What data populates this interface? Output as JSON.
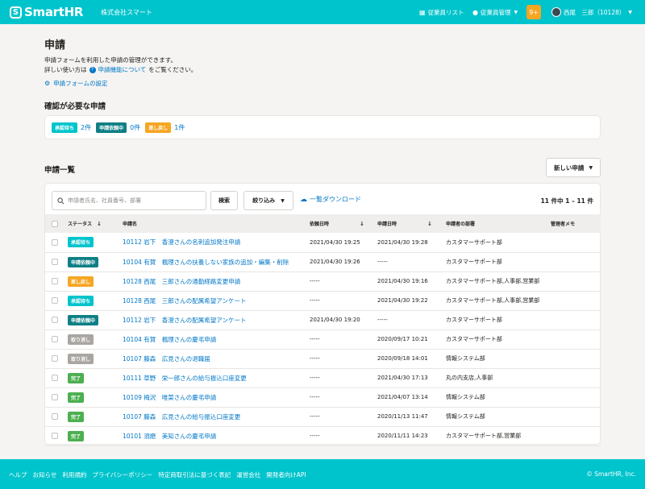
{
  "header": {
    "logo_mark": "S",
    "logo_text": "SmartHR",
    "company": "株式会社スマート",
    "nav_employee_list": "従業員リスト",
    "nav_employee_manage": "従業員管理",
    "notifications": "9+",
    "user": "西尾　三郎（10128）"
  },
  "page": {
    "title": "申請",
    "desc1": "申請フォームを利用した申請の管理ができます。",
    "desc2_pre": "詳しい使い方は",
    "desc2_link": "申請機能について",
    "desc2_post": "をご覧ください。",
    "settings_link": "申請フォームの設定"
  },
  "confirm": {
    "title": "確認が必要な申請",
    "items": [
      {
        "label": "承認待ち",
        "count": "2件",
        "color": "#00c4cc"
      },
      {
        "label": "申請依頼中",
        "count": "0件",
        "color": "#0f7f85"
      },
      {
        "label": "差し戻し",
        "count": "1件",
        "color": "#f5a623"
      }
    ]
  },
  "list": {
    "title": "申請一覧",
    "new_button": "新しい申請",
    "search_placeholder": "申請者氏名、社員番号、部署",
    "search_button": "検索",
    "filter_button": "絞り込み",
    "download_link": "一覧ダウンロード",
    "count_text": "11 件中 1 – 11 件",
    "columns": {
      "status": "ステータス",
      "name": "申請名",
      "requested": "依頼日時",
      "applied": "申請日時",
      "dept": "申請者の部署",
      "memo": "管理者メモ"
    },
    "rows": [
      {
        "status": "承認待ち",
        "color": "#00c4cc",
        "name": "10112 岩下　香澄さんの名刺追加発注申請",
        "requested": "2021/04/30 19:25",
        "applied": "2021/04/30 19:28",
        "dept": "カスタマーサポート部"
      },
      {
        "status": "申請依頼中",
        "color": "#0f7f85",
        "name": "10104 有賀　楓理さんの扶養しない家族の追加・編集・削除",
        "requested": "2021/04/30 19:26",
        "applied": "-----",
        "dept": "カスタマーサポート部"
      },
      {
        "status": "差し戻し",
        "color": "#f5a623",
        "name": "10128 西尾　三郎さんの通勤経路変更申請",
        "requested": "-----",
        "applied": "2021/04/30 19:16",
        "dept": "カスタマーサポート部,人事部,営業部"
      },
      {
        "status": "承認待ち",
        "color": "#00c4cc",
        "name": "10128 西尾　三郎さんの配属希望アンケート",
        "requested": "-----",
        "applied": "2021/04/30 19:22",
        "dept": "カスタマーサポート部,人事部,営業部"
      },
      {
        "status": "申請依頼中",
        "color": "#0f7f85",
        "name": "10112 岩下　香澄さんの配属希望アンケート",
        "requested": "2021/04/30 19:20",
        "applied": "-----",
        "dept": "カスタマーサポート部"
      },
      {
        "status": "取り消し",
        "color": "#a9a5a0",
        "name": "10104 有賀　楓理さんの慶弔申請",
        "requested": "-----",
        "applied": "2020/09/17 10:21",
        "dept": "カスタマーサポート部"
      },
      {
        "status": "取り消し",
        "color": "#a9a5a0",
        "name": "10107 藤森　広見さんの退職届",
        "requested": "-----",
        "applied": "2020/09/18 14:01",
        "dept": "情報システム部"
      },
      {
        "status": "完了",
        "color": "#4caf50",
        "name": "10111 草野　栄一郎さんの給与振込口座変更",
        "requested": "-----",
        "applied": "2021/04/30 17:13",
        "dept": "丸の内支店,人事部"
      },
      {
        "status": "完了",
        "color": "#4caf50",
        "name": "10109 梅沢　唯菜さんの慶弔申請",
        "requested": "-----",
        "applied": "2021/04/07 13:14",
        "dept": "情報システム部"
      },
      {
        "status": "完了",
        "color": "#4caf50",
        "name": "10107 藤森　広見さんの給与振込口座変更",
        "requested": "-----",
        "applied": "2020/11/13 11:47",
        "dept": "情報システム部"
      },
      {
        "status": "完了",
        "color": "#4caf50",
        "name": "10101 須磨　美知さんの慶弔申請",
        "requested": "-----",
        "applied": "2020/11/11 14:23",
        "dept": "カスタマーサポート部,営業部"
      }
    ]
  },
  "footer": {
    "links": [
      "ヘルプ",
      "お知らせ",
      "利用規約",
      "プライバシーポリシー",
      "特定商取引法に基づく表記",
      "運営会社",
      "開発者向けAPI"
    ],
    "copyright": "© SmartHR, Inc."
  }
}
